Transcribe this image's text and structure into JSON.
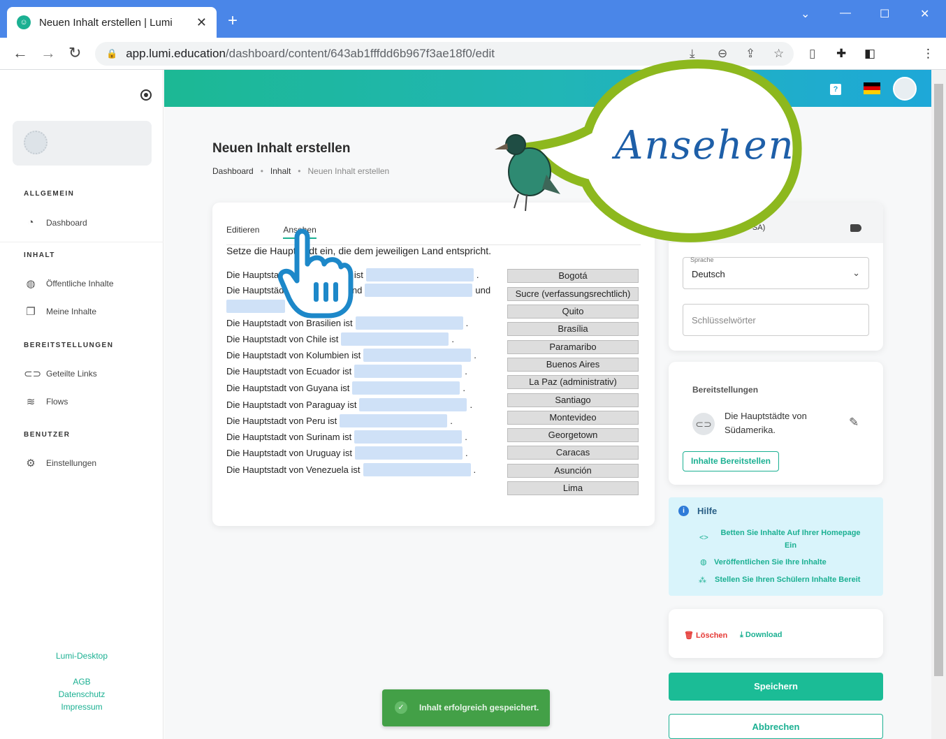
{
  "browser": {
    "tab_title": "Neuen Inhalt erstellen | Lumi",
    "url_host": "app.lumi.education",
    "url_path": "/dashboard/content/643ab1fffdd6b967f3ae18f0/edit"
  },
  "sidebar": {
    "sections": [
      {
        "title": "ALLGEMEIN",
        "items": [
          {
            "label": "Dashboard",
            "icon": "gauge-icon"
          }
        ]
      },
      {
        "title": "INHALT",
        "items": [
          {
            "label": "Öffentliche Inhalte",
            "icon": "globe-icon"
          },
          {
            "label": "Meine Inhalte",
            "icon": "copy-icon"
          }
        ]
      },
      {
        "title": "BEREITSTELLUNGEN",
        "items": [
          {
            "label": "Geteilte Links",
            "icon": "link-icon"
          },
          {
            "label": "Flows",
            "icon": "waves-icon"
          }
        ]
      },
      {
        "title": "BENUTZER",
        "items": [
          {
            "label": "Einstellungen",
            "icon": "gear-icon"
          }
        ]
      }
    ],
    "footer": {
      "desktop": "Lumi-Desktop",
      "agb": "AGB",
      "privacy": "Datenschutz",
      "imprint": "Impressum"
    }
  },
  "topbar": {
    "help": "?"
  },
  "page": {
    "title": "Neuen Inhalt erstellen",
    "breadcrumbs": [
      "Dashboard",
      "Inhalt",
      "Neuen Inhalt erstellen"
    ]
  },
  "editor": {
    "tabs": [
      "Editieren",
      "Ansehen"
    ],
    "task": "Setze die Hauptstadt ein, die dem jeweiligen Land entspricht.",
    "sentences": [
      {
        "text": "Die Hauptstadt von Argentinien ist",
        "after": "."
      },
      {
        "text": "Die Hauptstädte von Bolivien sind",
        "after": "und"
      },
      {
        "text": "",
        "after": ""
      },
      {
        "text": "Die Hauptstadt von Brasilien ist",
        "after": "."
      },
      {
        "text": "Die Hauptstadt von Chile ist",
        "after": "."
      },
      {
        "text": "Die Hauptstadt von Kolumbien ist",
        "after": "."
      },
      {
        "text": "Die Hauptstadt von Ecuador ist",
        "after": "."
      },
      {
        "text": "Die Hauptstadt von Guyana ist",
        "after": "."
      },
      {
        "text": "Die Hauptstadt von Paraguay ist",
        "after": "."
      },
      {
        "text": "Die Hauptstadt von Peru ist",
        "after": "."
      },
      {
        "text": "Die Hauptstadt von Surinam ist",
        "after": "."
      },
      {
        "text": "Die Hauptstadt von Uruguay ist",
        "after": "."
      },
      {
        "text": "Die Hauptstadt von Venezuela ist",
        "after": "."
      }
    ],
    "choices": [
      "Bogotá",
      "Sucre (verfassungsrechtlich)",
      "Quito",
      "Brasília",
      "Paramaribo",
      "Buenos Aires",
      "La Paz (administrativ)",
      "Santiago",
      "Montevideo",
      "Georgetown",
      "Caracas",
      "Asunción",
      "Lima"
    ]
  },
  "meta": {
    "license": "(CC BY-SA)",
    "language_label": "Sprache",
    "language_value": "Deutsch",
    "keywords_placeholder": "Schlüsselwörter"
  },
  "deploy": {
    "title": "Bereitstellungen",
    "item_name": "Die Hauptstädte von Südamerika.",
    "button": "Inhalte Bereitstellen"
  },
  "help": {
    "title": "Hilfe",
    "links": [
      "Betten Sie Inhalte Auf Ihrer Homepage Ein",
      "Veröffentlichen Sie Ihre Inhalte",
      "Stellen Sie Ihren Schülern Inhalte Bereit"
    ]
  },
  "actions": {
    "delete": "Löschen",
    "download": "Download",
    "save": "Speichern",
    "cancel": "Abbrechen"
  },
  "toast": "Inhalt erfolgreich gespeichert.",
  "overlay": {
    "bubble_text": "Ansehen"
  },
  "colors": {
    "brand": "#1bb092",
    "blank": "#cfe1f7",
    "bubble": "#8db81e",
    "bubble_text": "#1e5fa8",
    "toast": "#43a047"
  }
}
